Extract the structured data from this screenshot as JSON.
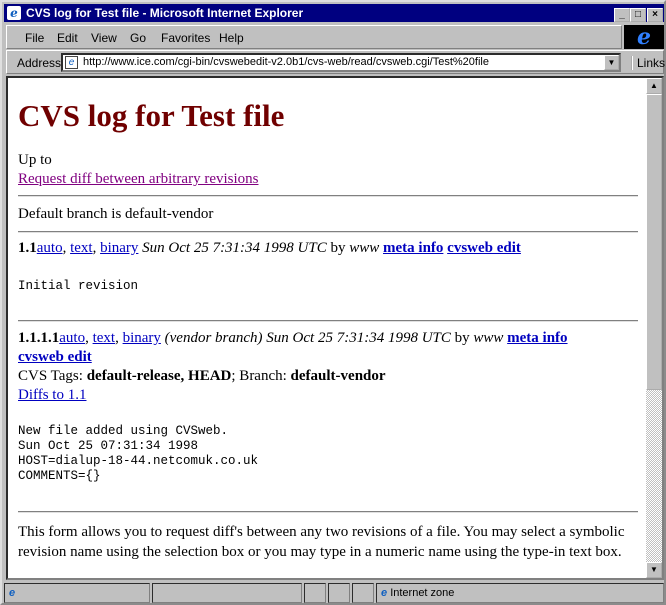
{
  "window": {
    "title": "CVS log for Test file - Microsoft Internet Explorer"
  },
  "menu": [
    "File",
    "Edit",
    "View",
    "Go",
    "Favorites",
    "Help"
  ],
  "address": {
    "label": "Address",
    "url": "http://www.ice.com/cgi-bin/cvswebedit-v2.0b1/cvs-web/read/cvsweb.cgi/Test%20file",
    "links": "Links"
  },
  "page": {
    "heading": "CVS log for Test file",
    "up_to": "Up to",
    "request_diff": "Request diff between arbitrary revisions",
    "default_branch": "Default branch is default-vendor",
    "rev1": {
      "num": "1.1",
      "auto": "auto",
      "text": "text",
      "binary": "binary",
      "date": "Sun Oct 25 7:31:34 1998 UTC",
      "by": "by",
      "author": "www",
      "meta": "meta info",
      "edit": "cvsweb edit",
      "log": "Initial revision"
    },
    "rev2": {
      "num": "1.1.1.1",
      "auto": "auto",
      "text": "text",
      "binary": "binary",
      "branch_note": "(vendor branch) Sun Oct 25 7:31:34 1998 UTC",
      "by": "by",
      "author": "www",
      "meta": "meta info",
      "edit": "cvsweb edit",
      "tags_label": "CVS Tags:",
      "tags": "default-release, HEAD",
      "branch_label": "; Branch:",
      "branch": "default-vendor",
      "diffs": "Diffs to 1.1",
      "log": "New file added using CVSweb.\nSun Oct 25 07:31:34 1998\nHOST=dialup-18-44.netcomuk.co.uk\nCOMMENTS={}"
    },
    "form_text_1": "This form allows you to request diff's between any two revisions of a file. You may select a symbolic",
    "form_text_2": "revision name using the selection box or you may type in a numeric name using the type-in text box."
  },
  "status": {
    "zone": "Internet zone"
  }
}
